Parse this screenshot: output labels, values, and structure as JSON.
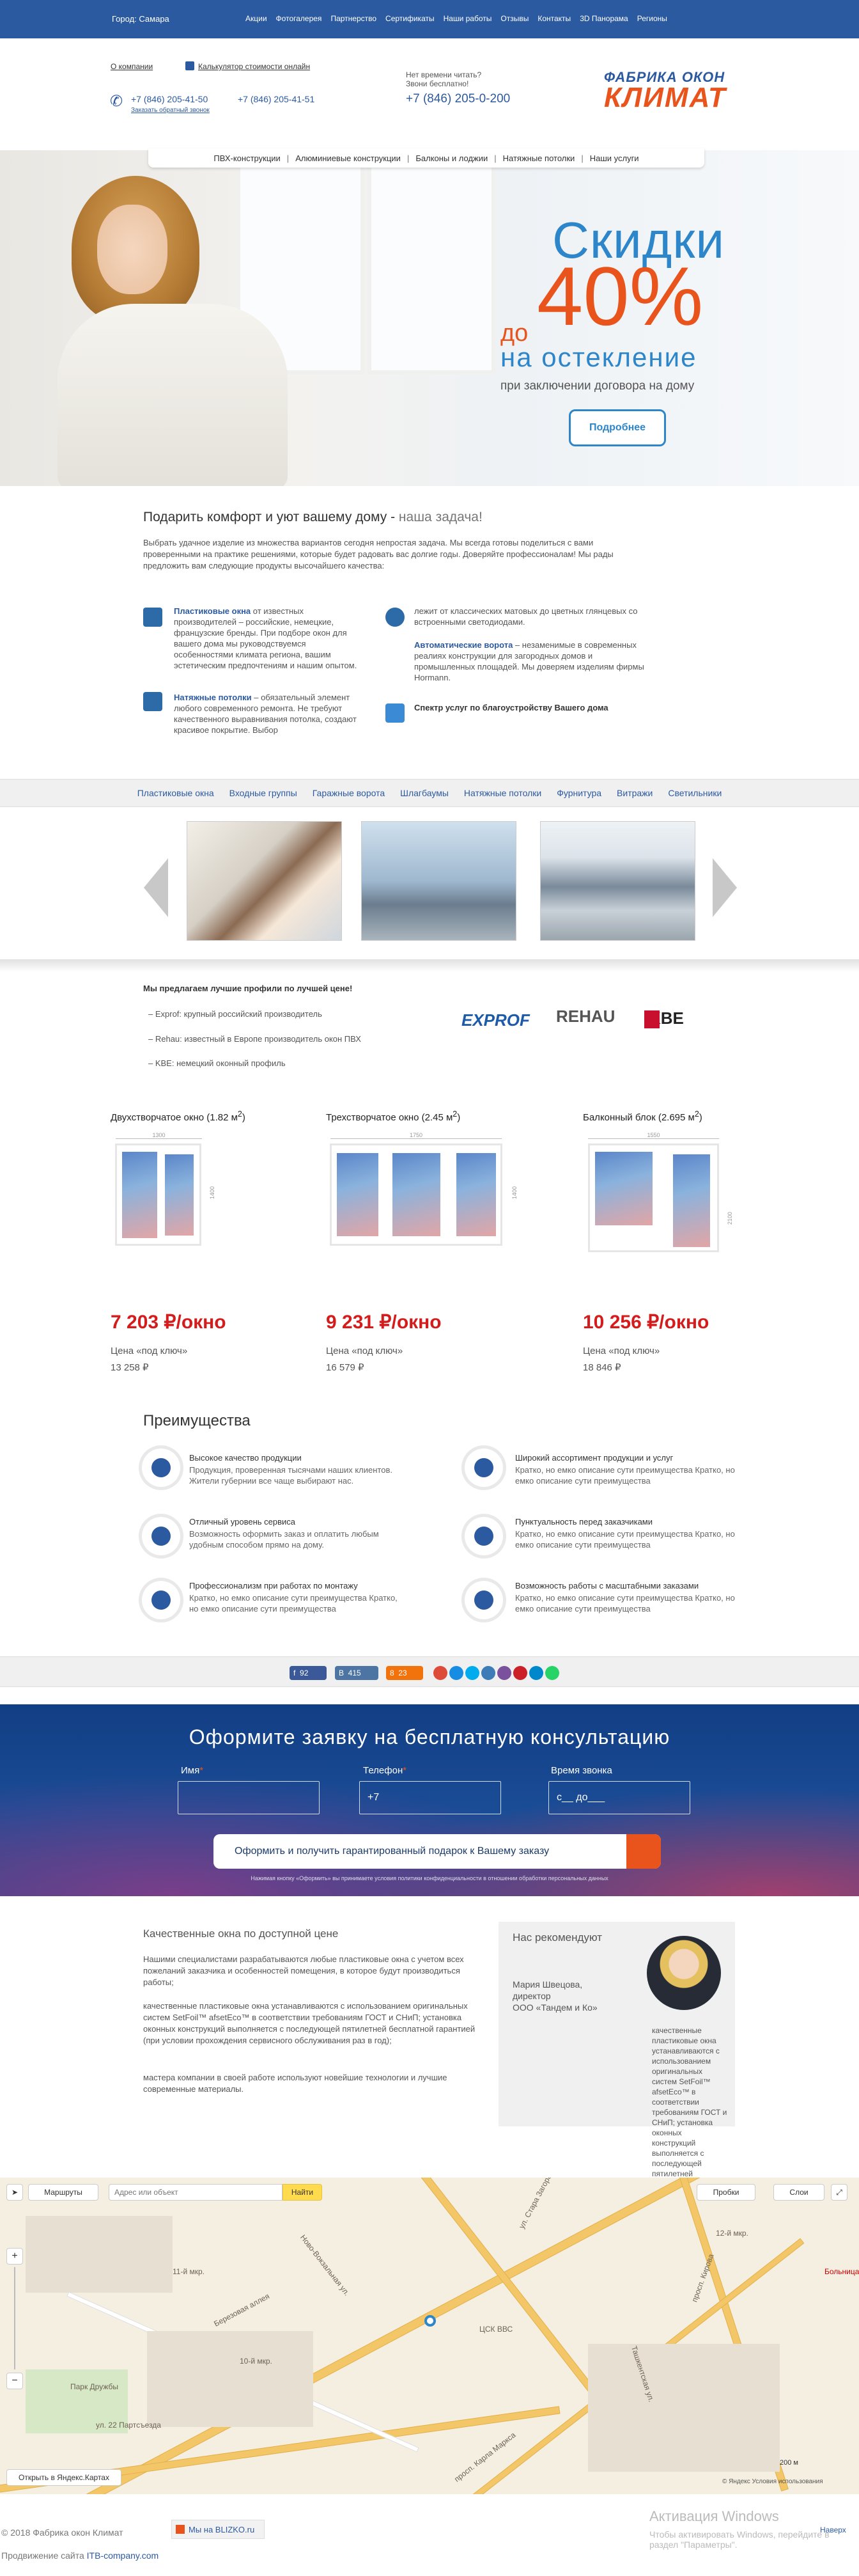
{
  "topbar": {
    "city": "Город: Самара",
    "nav": [
      "Акции",
      "Фотогалерея",
      "Партнерство",
      "Сертификаты",
      "Наши работы",
      "Отзывы",
      "Контакты",
      "3D Панорама",
      "Регионы"
    ]
  },
  "header": {
    "about": "О компании",
    "calculator": "Калькулятор стоимости онлайн",
    "phone1": "+7 (846) 205-41-50",
    "phone2": "+7 (846) 205-41-51",
    "callback": "Заказать обратный звонок",
    "no_time_1": "Нет времени читать?",
    "no_time_2": "Звони бесплатно!",
    "free_phone": "+7 (846) 205-0-200",
    "logo_line1": "ФАБРИКА ОКОН",
    "logo_line2": "КЛИМАТ"
  },
  "submenu": [
    "ПВХ-конструкции",
    "Алюминиевые конструкции",
    "Балконы и лоджии",
    "Натяжные потолки",
    "Наши услуги"
  ],
  "hero": {
    "line1": "Скидки",
    "do": "до",
    "percent": "40%",
    "line3": "на остекление",
    "line4": "при заключении договора на дому",
    "button": "Подробнее"
  },
  "intro": {
    "title": "Подарить комфорт и уют вашему дому -",
    "title_em": " наша задача!",
    "text": "Выбрать удачное изделие из множества вариантов сегодня непростая задача. Мы всегда готовы поделиться с вами проверенными на практике решениями, которые будет радовать вас долгие годы. Доверяйте профессионалам! Мы рады предложить вам следующие продукты высочайшего качества:",
    "p1_title": "Пластиковые окна",
    "p1_text": " от известных производителей – российские, немецкие, французские бренды. При подборе окон для вашего дома мы руководствуемся особенностями климата региона, вашим эстетическим предпочтениям и нашим опытом.",
    "p2_title": "Натяжные потолки",
    "p2_text": " – обязательный элемент любого современного ремонта. Не требуют качественного выравнивания потолка, создают красивое покрытие. Выбор",
    "p3_text": "лежит от классических матовых до цветных глянцевых со встроенными светодиодами.",
    "p4_title": "Автоматические ворота",
    "p4_text": " – незаменимые в современных реалиях конструкции для загородных домов и промышленных площадей. Мы доверяем изделиям фирмы Hormann.",
    "p5_title": "Спектр услуг по благоустройству Вашего дома"
  },
  "catnav": [
    "Пластиковые окна",
    "Входные группы",
    "Гаражные ворота",
    "Шлагбаумы",
    "Натяжные потолки",
    "Фурнитура",
    "Витражи",
    "Светильники"
  ],
  "profiles": {
    "title": "Мы предлагаем лучшие профили по лучшей цене!",
    "lines": [
      "– Exprof: крупный российский производитель",
      "– Rehau: известный в Европе производитель окон ПВХ",
      "– KBE: немецкий оконный профиль"
    ],
    "brands": [
      "EXPROF",
      "REHAU",
      "KBE"
    ]
  },
  "windows": [
    {
      "title": "Двухстворчатое окно (1.82 м",
      "sup": "2",
      "close": ")",
      "price": "7 203 ₽/окно",
      "sub": "Цена «под ключ»",
      "old": "13 258 ₽",
      "w": "1300",
      "h": "1400"
    },
    {
      "title": "Трехстворчатое окно (2.45 м",
      "sup": "2",
      "close": ")",
      "price": "9 231 ₽/окно",
      "sub": "Цена «под ключ»",
      "old": "16 579 ₽",
      "w": "1750",
      "h": "1400"
    },
    {
      "title": "Балконный блок (2.695 м",
      "sup": "2",
      "close": ")",
      "price": "10 256 ₽/окно",
      "sub": "Цена «под ключ»",
      "old": "18 846 ₽",
      "w": "1550",
      "h": "2100"
    }
  ],
  "advantages": {
    "title": "Преимущества",
    "items": [
      {
        "t": "Высокое качество продукции",
        "d": "Продукция, проверенная тысячами наших клиентов. Жители губернии все чаще выбирают нас."
      },
      {
        "t": "Широкий ассортимент продукции и услуг",
        "d": "Кратко, но емко описание сути преимущества Кратко, но емко описание сути преимущества"
      },
      {
        "t": "Отличный уровень сервиса",
        "d": "Возможность оформить заказ и оплатить любым удобным способом прямо на дому."
      },
      {
        "t": "Пунктуальность перед заказчиками",
        "d": "Кратко, но емко описание сути преимущества Кратко, но емко описание сути преимущества"
      },
      {
        "t": "Профессионализм при работах по монтажу",
        "d": "Кратко, но емко описание сути преимущества Кратко, но емко описание сути преимущества"
      },
      {
        "t": "Возможность работы с масштабными заказами",
        "d": "Кратко, но емко описание сути преимущества Кратко, но емко описание сути преимущества"
      }
    ]
  },
  "share": {
    "fb": "92",
    "vk": "415",
    "ok": "23"
  },
  "form": {
    "title": "Оформите заявку на бесплатную консультацию",
    "name_label": "Имя",
    "phone_label": "Телефон",
    "time_label": "Время звонка",
    "phone_value": "+7",
    "time_value": "с__ до___",
    "button": "Оформить и получить гарантированный подарок к Вашему заказу",
    "consent": "Нажимая кнопку «Оформить» вы принимаете условия политики конфиденциальности в отношении обработки персональных данных"
  },
  "quality": {
    "title": "Качественные окна по доступной цене",
    "p1": "Нашими специалистами разрабатываются любые пластиковые окна с учетом всех пожеланий заказчика и особенностей помещения, в которое будут производиться работы;",
    "p2": "качественные пластиковые окна устанавливаются с использованием оригинальных систем SetFoil™ afsetEco™ в соответствии требованиям ГОСТ и СНиП; установка оконных конструкций выполняется с последующей пятилетней бесплатной гарантией (при условии прохождения сервисного обслуживания раз в год);",
    "p3": "мастера компании в своей работе используют новейшие технологии и лучшие современные материалы."
  },
  "recommend": {
    "title": "Нас рекомендуют",
    "name": "Мария Швецова,",
    "role": "директор",
    "company": "ООО «Тандем и Ко»",
    "text": "качественные пластиковые окна устанавливаются с использованием оригинальных систем SetFoil™ afsetEco™ в соответствии требованиям ГОСТ и СНиП; установка оконных конструкций выполняется с последующей пятилетней бесплатной гарантией (при условии прохождения"
  },
  "map": {
    "routes": "Маршруты",
    "search_placeholder": "Адрес или объект",
    "find": "Найти",
    "traffic": "Пробки",
    "layers": "Слои",
    "open_yandex": "Открыть в Яндекс.Картах",
    "labels": [
      "11-й мкр.",
      "10-й мкр.",
      "12-й мкр.",
      "ул. Стара Загора",
      "ул. 22 Партсъезда",
      "просп. Кирова",
      "Ново-Вокзальная ул.",
      "Березовая аллея",
      "просп. Карла Маркса",
      "Ташкентская ул.",
      "ЦСК ВВС",
      "Парк Дружбы",
      "Больница"
    ],
    "scale": "200 м",
    "copyright": "© Яндекс Условия использования"
  },
  "footer": {
    "copyright": "© 2018 Фабрика окон Климат",
    "bluzko": "Мы на BLIZKO.ru",
    "dev": "Продвижение сайта ",
    "dev_link": "ITB-company.com",
    "activation_title": "Активация Windows",
    "activation_text": "Чтобы активировать Windows, перейдите в раздел \"Параметры\".",
    "top": "Наверх"
  },
  "colors": {
    "brand_blue": "#2c5aa0",
    "accent_orange": "#e8541c",
    "price_red": "#d41c1c"
  }
}
